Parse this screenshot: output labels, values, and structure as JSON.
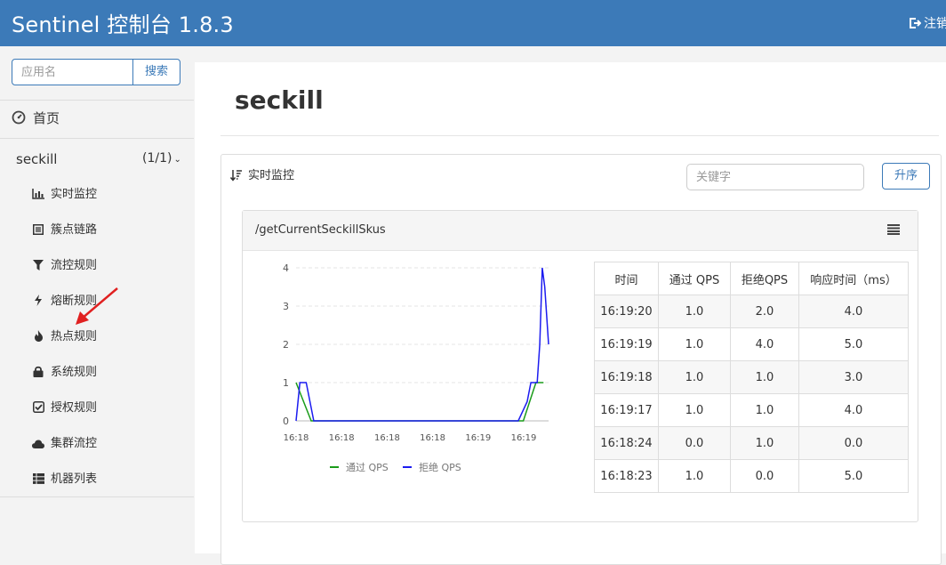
{
  "header": {
    "brand": "Sentinel 控制台 1.8.3",
    "logout_label": "注销"
  },
  "sidebar": {
    "search_placeholder": "应用名",
    "search_button": "搜索",
    "home_label": "首页",
    "app": {
      "name": "seckill",
      "count": "(1/1)",
      "menu": [
        {
          "label": "实时监控",
          "icon": "bar-chart-icon"
        },
        {
          "label": "簇点链路",
          "icon": "list-icon"
        },
        {
          "label": "流控规则",
          "icon": "filter-icon"
        },
        {
          "label": "熔断规则",
          "icon": "bolt-icon"
        },
        {
          "label": "热点规则",
          "icon": "fire-icon"
        },
        {
          "label": "系统规则",
          "icon": "lock-icon"
        },
        {
          "label": "授权规则",
          "icon": "check-square-icon"
        },
        {
          "label": "集群流控",
          "icon": "cloud-icon"
        },
        {
          "label": "机器列表",
          "icon": "th-list-icon"
        }
      ]
    }
  },
  "main": {
    "page_title": "seckill",
    "panel": {
      "title": "实时监控",
      "keyword_placeholder": "关键字",
      "sort_button": "升序"
    },
    "resource": {
      "name": "/getCurrentSeckillSkus",
      "table": {
        "headers": [
          "时间",
          "通过 QPS",
          "拒绝QPS",
          "响应时间（ms）"
        ],
        "rows": [
          [
            "16:19:20",
            "1.0",
            "2.0",
            "4.0"
          ],
          [
            "16:19:19",
            "1.0",
            "4.0",
            "5.0"
          ],
          [
            "16:19:18",
            "1.0",
            "1.0",
            "3.0"
          ],
          [
            "16:19:17",
            "1.0",
            "1.0",
            "4.0"
          ],
          [
            "16:18:24",
            "0.0",
            "1.0",
            "0.0"
          ],
          [
            "16:18:23",
            "1.0",
            "0.0",
            "5.0"
          ]
        ]
      }
    }
  },
  "colors": {
    "header_bg": "#3c7ab8",
    "pass_series": "#1a9c1a",
    "block_series": "#1c1cf0"
  },
  "chart_data": {
    "type": "line",
    "x_tick_labels": [
      "16:18",
      "16:18",
      "16:18",
      "16:18",
      "16:19",
      "16:19"
    ],
    "y_ticks": [
      0,
      1,
      2,
      3,
      4
    ],
    "ylim": [
      0,
      4
    ],
    "legend": [
      "通过 QPS",
      "拒绝 QPS"
    ],
    "legend_position": "bottom",
    "series": [
      {
        "name": "通过 QPS",
        "color": "#1a9c1a",
        "points": [
          [
            0.0,
            1
          ],
          [
            0.06,
            0
          ],
          [
            0.9,
            0
          ],
          [
            0.95,
            1
          ],
          [
            0.98,
            1
          ]
        ]
      },
      {
        "name": "拒绝 QPS",
        "color": "#1c1cf0",
        "points": [
          [
            0.0,
            0
          ],
          [
            0.015,
            1
          ],
          [
            0.04,
            1
          ],
          [
            0.07,
            0
          ],
          [
            0.88,
            0
          ],
          [
            0.915,
            0.5
          ],
          [
            0.93,
            1
          ],
          [
            0.955,
            1
          ],
          [
            0.965,
            2
          ],
          [
            0.975,
            4
          ],
          [
            0.985,
            3.5
          ],
          [
            1.0,
            2
          ]
        ]
      }
    ]
  }
}
